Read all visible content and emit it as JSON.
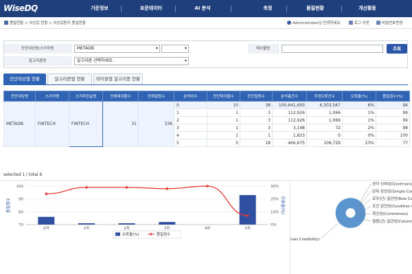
{
  "app": {
    "logo": "WiseDQ",
    "menu": [
      "기준정보",
      "표준데이터",
      "AI 분석",
      "측정",
      "품질현황",
      "개선활동"
    ]
  },
  "infobar": {
    "breadcrumb": "품질현황 > 이상값 현황 > 이상값탐지 품질현황",
    "user": "Administrator님 안녕하세요",
    "logout": "로그 아웃",
    "change_password": "비밀번호변경"
  },
  "search": {
    "target_label": "진단대상명/스키마명",
    "target_value": "METADB",
    "table_label": "테이블명",
    "table_value": "",
    "algo_label": "알고리즘명",
    "algo_value": "알고리즘 선택하세요.",
    "button": "조회"
  },
  "tabs": [
    "진단대상별 현황",
    "알고리즘별 현황",
    "테이블별 알고리즘 현황"
  ],
  "table": {
    "headers": [
      "진단대상명",
      "스키마명",
      "스키마한글명",
      "전체테이블수",
      "전체컬럼수",
      "분석차수",
      "진단테이블수",
      "진단컬럼수",
      "분석총건수",
      "추정오류건수",
      "오류율(%)",
      "품질점수(%)"
    ],
    "group": {
      "target": "METADB",
      "schema": "FINTECH",
      "schema_kr": "FINTECH",
      "tables": "31",
      "columns": "336"
    },
    "rows": [
      [
        "0",
        "10",
        "38",
        "100,641,693",
        "6,303,567",
        "6%",
        "94"
      ],
      [
        "1",
        "1",
        "3",
        "112,926",
        "1,066",
        "1%",
        "99"
      ],
      [
        "2",
        "1",
        "3",
        "112,926",
        "1,066",
        "1%",
        "99"
      ],
      [
        "3",
        "1",
        "3",
        "3,198",
        "72",
        "2%",
        "98"
      ],
      [
        "4",
        "1",
        "1",
        "1,823",
        "0",
        "0%",
        "100"
      ],
      [
        "5",
        "5",
        "18",
        "466,675",
        "108,729",
        "23%",
        "77"
      ]
    ]
  },
  "status_text": "selected 1 / total 6",
  "colors": {
    "nav": "#1f3f7c",
    "header": "#2f63b3",
    "bar": "#2f4fa0",
    "line": "#e53935",
    "donut": "#5b95cf"
  },
  "chart_data": [
    {
      "type": "bar",
      "categories": [
        "0차",
        "1차",
        "2차",
        "3차",
        "4차",
        "5차"
      ],
      "series": [
        {
          "name": "오류율(%)",
          "type": "bar",
          "axis": "right",
          "values": [
            6,
            1,
            1,
            2,
            0,
            23
          ]
        },
        {
          "name": "품질점수",
          "type": "line",
          "axis": "left",
          "values": [
            94,
            99,
            99,
            98,
            100,
            77
          ]
        }
      ],
      "ylabel": "품질점수",
      "y2label": "오류율(%)",
      "ylim": [
        70,
        100
      ],
      "y2lim": [
        0,
        30
      ],
      "yticks": [
        "70",
        "80",
        "90",
        "100"
      ],
      "y2ticks": [
        "0%",
        "10%",
        "20%",
        "30%"
      ],
      "legend_position": "bottom-center",
      "grid": true
    },
    {
      "type": "pie",
      "categories": [
        "관리 신뢰성(Governance Cr",
        "단독 완전성(Simple Completer",
        "로우(간) 일관성(Row Consis",
        "조건 완전성(Condition Co",
        "최신성(Currentness)",
        "컬럼(간) 일관성(Column Co",
        "lues Credibility)"
      ],
      "legend_position": "right"
    }
  ]
}
